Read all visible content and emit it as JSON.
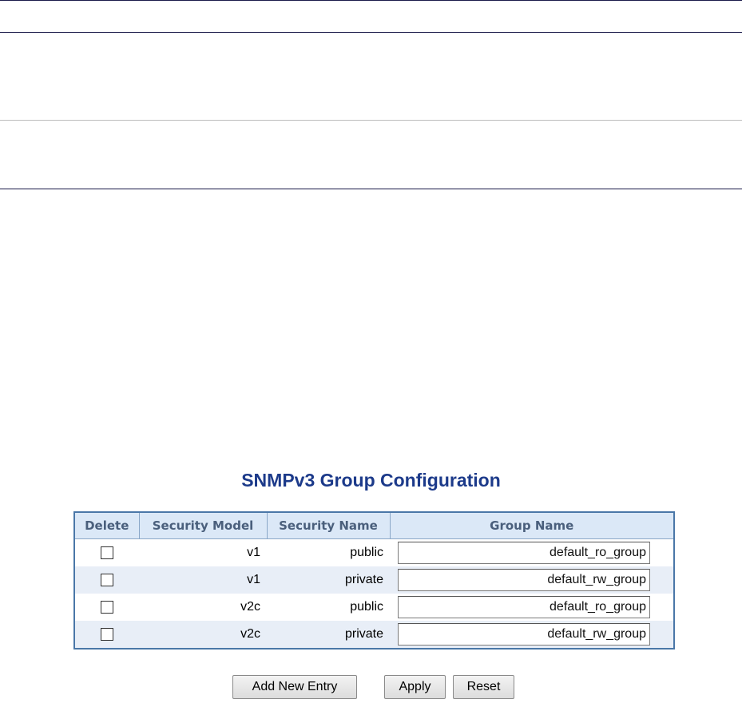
{
  "page": {
    "title": "SNMPv3 Group Configuration"
  },
  "table": {
    "headers": {
      "delete": "Delete",
      "security_model": "Security Model",
      "security_name": "Security Name",
      "group_name": "Group Name"
    },
    "rows": [
      {
        "security_model": "v1",
        "security_name": "public",
        "group_name": "default_ro_group"
      },
      {
        "security_model": "v1",
        "security_name": "private",
        "group_name": "default_rw_group"
      },
      {
        "security_model": "v2c",
        "security_name": "public",
        "group_name": "default_ro_group"
      },
      {
        "security_model": "v2c",
        "security_name": "private",
        "group_name": "default_rw_group"
      }
    ]
  },
  "buttons": {
    "add_new_entry": "Add New Entry",
    "apply": "Apply",
    "reset": "Reset"
  }
}
